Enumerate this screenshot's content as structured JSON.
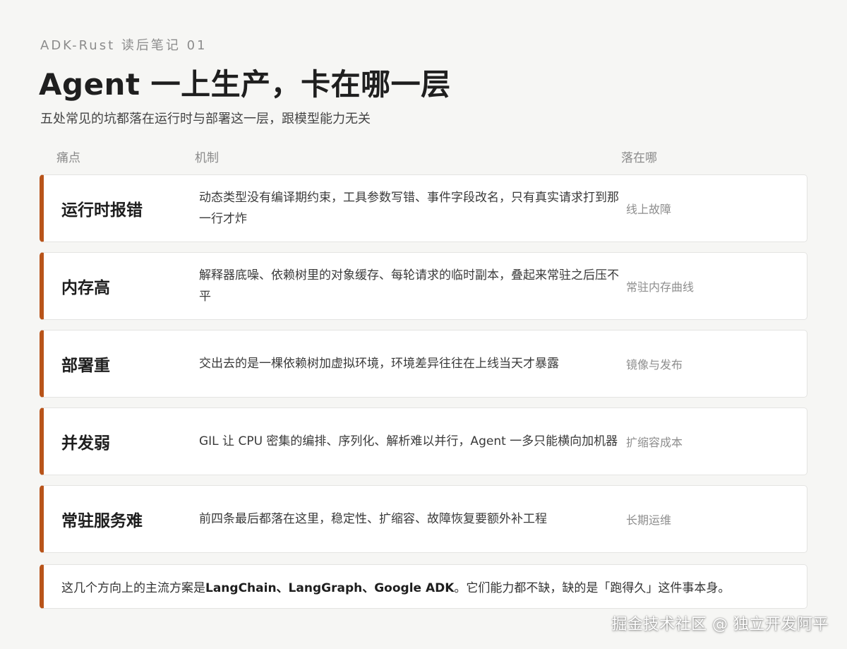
{
  "header": {
    "kicker": "ADK-Rust 读后笔记 01",
    "title": "Agent 一上生产，卡在哪一层",
    "subtitle": "五处常见的坑都落在运行时与部署这一层，跟模型能力无关"
  },
  "columns": [
    "痛点",
    "机制",
    "落在哪"
  ],
  "rows": [
    {
      "pain": "运行时报错",
      "mechanism": "动态类型没有编译期约束，工具参数写错、事件字段改名，只有真实请求打到那一行才炸",
      "where": "线上故障"
    },
    {
      "pain": "内存高",
      "mechanism": "解释器底噪、依赖树里的对象缓存、每轮请求的临时副本，叠起来常驻之后压不平",
      "where": "常驻内存曲线"
    },
    {
      "pain": "部署重",
      "mechanism": "交出去的是一棵依赖树加虚拟环境，环境差异往往在上线当天才暴露",
      "where": "镜像与发布"
    },
    {
      "pain": "并发弱",
      "mechanism": "GIL 让 CPU 密集的编排、序列化、解析难以并行，Agent 一多只能横向加机器",
      "where": "扩缩容成本"
    },
    {
      "pain": "常驻服务难",
      "mechanism": "前四条最后都落在这里，稳定性、扩缩容、故障恢复要额外补工程",
      "where": "长期运维"
    }
  ],
  "footer": {
    "prefix": "这几个方向上的主流方案是 ",
    "highlight": "LangChain、LangGraph、Google ADK",
    "suffix": "。它们能力都不缺，缺的是「跑得久」这件事本身。"
  },
  "watermark": "掘金技术社区 @ 独立开发阿平",
  "colors": {
    "accent": "#b8541a",
    "background": "#f6f6f4",
    "card": "#ffffff"
  }
}
